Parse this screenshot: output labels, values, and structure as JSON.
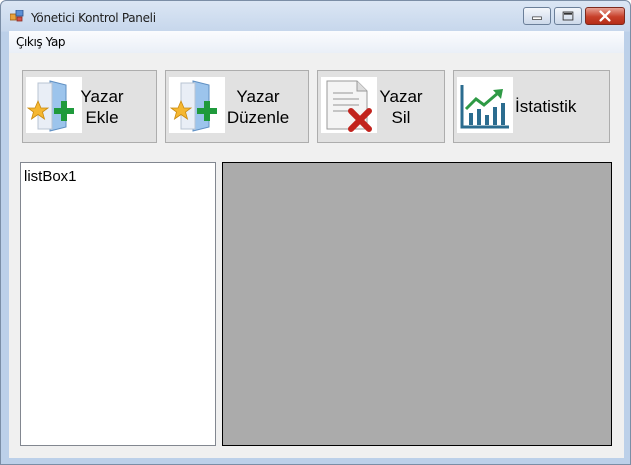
{
  "window": {
    "title": "Yönetici Kontrol Paneli"
  },
  "menu": {
    "items": [
      {
        "label": "Çıkış Yap"
      }
    ]
  },
  "toolbar": {
    "buttons": [
      {
        "line1": "Yazar",
        "line2": "Ekle",
        "icon": "add-author-icon"
      },
      {
        "line1": "Yazar",
        "line2": "Düzenle",
        "icon": "edit-author-icon"
      },
      {
        "line1": "Yazar",
        "line2": "Sil",
        "icon": "delete-document-icon"
      },
      {
        "line1": "İstatistik",
        "line2": "",
        "icon": "statistics-chart-icon"
      }
    ]
  },
  "listbox": {
    "items": [
      "listBox1"
    ]
  },
  "colors": {
    "panel_background": "#ababab",
    "button_face": "#e1e1e1",
    "close_button": "#c7402a"
  }
}
